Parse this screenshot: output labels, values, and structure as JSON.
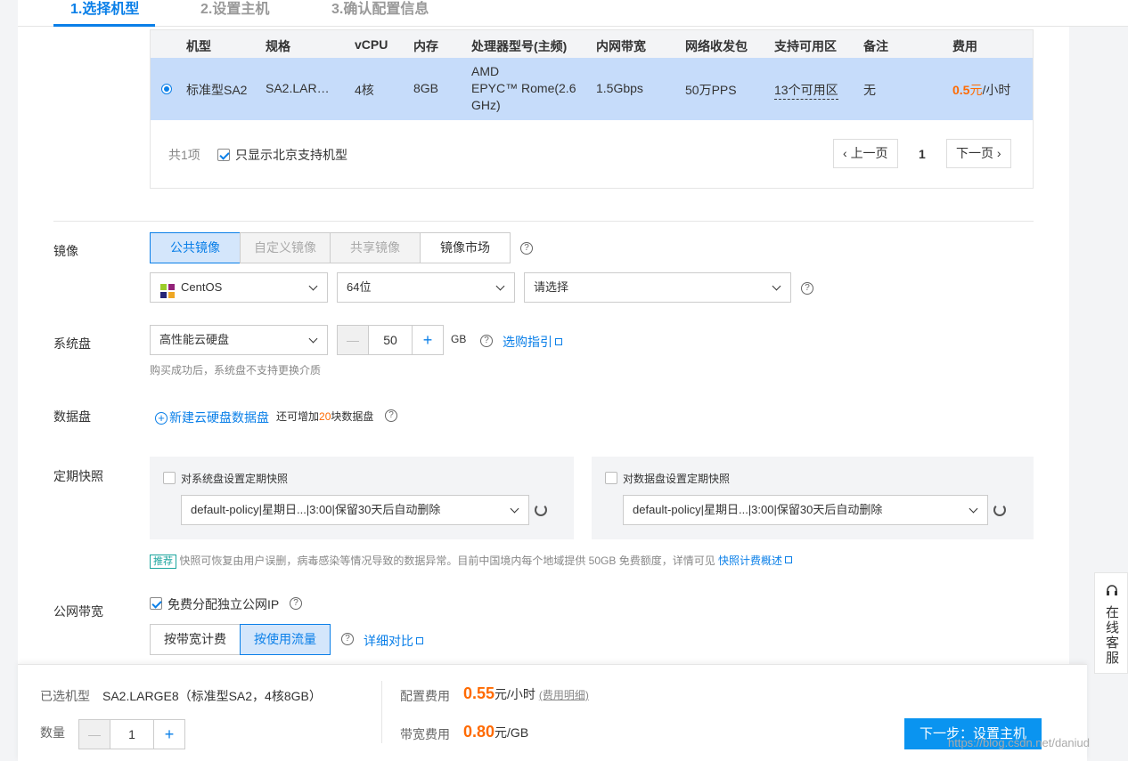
{
  "steps": [
    {
      "label": "1.选择机型"
    },
    {
      "label": "2.设置主机"
    },
    {
      "label": "3.确认配置信息"
    }
  ],
  "table": {
    "headers": [
      "机型",
      "规格",
      "vCPU",
      "内存",
      "处理器型号(主频)",
      "内网带宽",
      "网络收发包",
      "支持可用区",
      "备注",
      "费用"
    ],
    "row": {
      "type": "标准型SA2",
      "spec": "SA2.LAR…",
      "vcpu": "4核",
      "mem": "8GB",
      "cpu_line1": "AMD",
      "cpu_line2": "EPYC™ Rome(2.6",
      "cpu_line3": "GHz)",
      "bandwidth": "1.5Gbps",
      "pps": "50万PPS",
      "zones": "13个可用区",
      "remark": "无",
      "price_num": "0.5",
      "price_unit_yuan": "元",
      "price_unit_rest": "/小时"
    },
    "count": "共1项",
    "filter_label": "只显示北京支持机型",
    "prev": "上一页",
    "page": "1",
    "next": "下一页"
  },
  "image": {
    "label": "镜像",
    "tabs": [
      "公共镜像",
      "自定义镜像",
      "共享镜像",
      "镜像市场"
    ],
    "os": "CentOS",
    "bits": "64位",
    "version_placeholder": "请选择"
  },
  "system_disk": {
    "label": "系统盘",
    "type": "高性能云硬盘",
    "minus": "—",
    "size": "50",
    "plus": "+",
    "unit": "GB",
    "guide": "选购指引",
    "note": "购买成功后，系统盘不支持更换介质"
  },
  "data_disk": {
    "label": "数据盘",
    "add": "新建云硬盘数据盘",
    "tip_pre": "还可增加",
    "tip_num": "20",
    "tip_post": "块数据盘"
  },
  "snapshot": {
    "label": "定期快照",
    "sys_check": "对系统盘设置定期快照",
    "sys_policy": "default-policy|星期日...|3:00|保留30天后自动删除",
    "data_check": "对数据盘设置定期快照",
    "data_policy": "default-policy|星期日...|3:00|保留30天后自动删除",
    "badge": "推荐",
    "note": "快照可恢复由用户误删，病毒感染等情况导致的数据异常。目前中国境内每个地域提供 50GB 免费额度，详情可见",
    "link": "快照计费概述"
  },
  "bandwidth": {
    "label": "公网带宽",
    "free_ip": "免费分配独立公网IP",
    "tabs": [
      "按带宽计费",
      "按使用流量"
    ],
    "compare": "详细对比"
  },
  "bottom": {
    "selected_label": "已选机型",
    "selected_value": "SA2.LARGE8（标准型SA2，4核8GB）",
    "qty_label": "数量",
    "qty_minus": "—",
    "qty_value": "1",
    "qty_plus": "+",
    "config_fee_label": "配置费用",
    "config_fee": "0.55",
    "config_fee_unit": "元/小时",
    "fee_detail": "(费用明细)",
    "bw_fee_label": "带宽费用",
    "bw_fee": "0.80",
    "bw_fee_unit": "元/GB",
    "next_btn": "下一步：设置主机"
  },
  "chat": {
    "label": "在线客服"
  },
  "watermark": "https://blog.csdn.net/daniud",
  "colors": {
    "accent": "#0a7fe8",
    "price": "#ff6a00",
    "selected_row": "#c6dcfa"
  }
}
